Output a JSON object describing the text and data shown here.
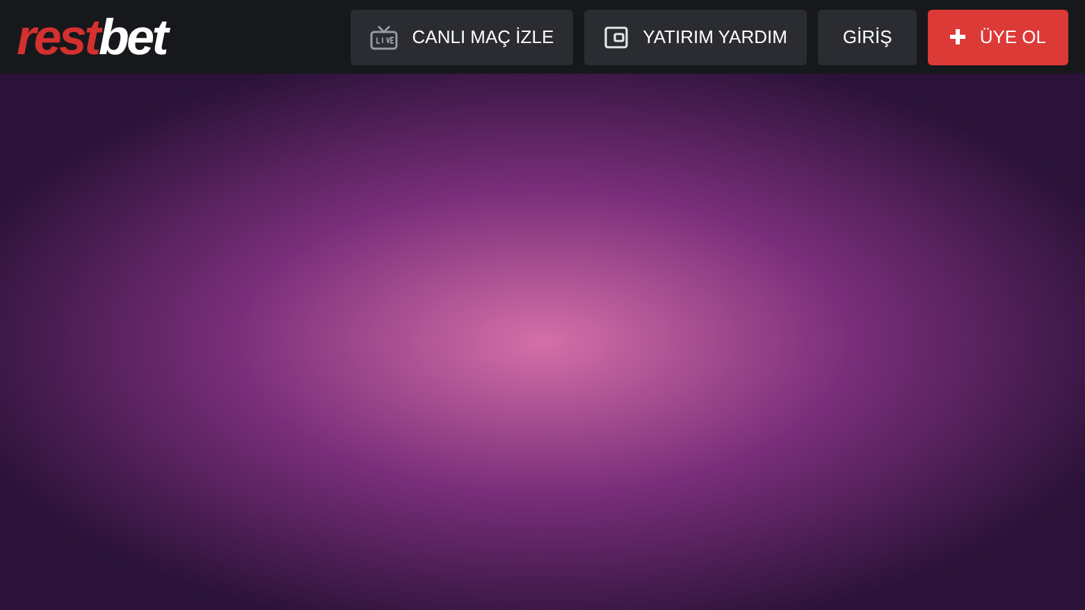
{
  "header": {
    "logo": {
      "part_1": "rest",
      "part_2": "bet"
    },
    "buttons": [
      {
        "kind": "live",
        "label": "CANLI MAÇ İZLE"
      },
      {
        "kind": "wallet",
        "label": "YATIRIM YARDIM"
      },
      {
        "kind": "plain",
        "label": "GİRİŞ"
      },
      {
        "kind": "signup",
        "label": "ÜYE OL"
      }
    ]
  }
}
